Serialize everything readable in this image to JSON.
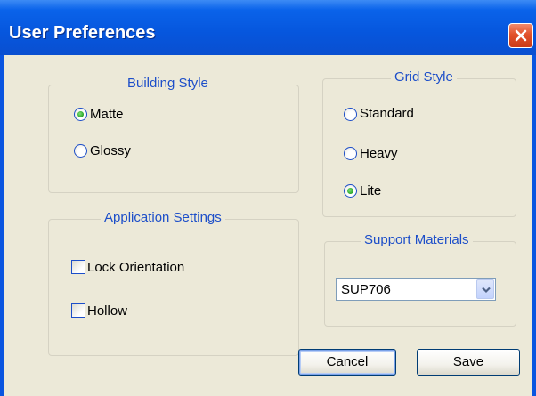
{
  "window": {
    "title": "User Preferences"
  },
  "building_style": {
    "legend": "Building Style",
    "options": [
      {
        "label": "Matte",
        "selected": true
      },
      {
        "label": "Glossy",
        "selected": false
      }
    ]
  },
  "grid_style": {
    "legend": "Grid Style",
    "options": [
      {
        "label": "Standard",
        "selected": false
      },
      {
        "label": "Heavy",
        "selected": false
      },
      {
        "label": "Lite",
        "selected": true
      }
    ]
  },
  "application_settings": {
    "legend": "Application Settings",
    "options": [
      {
        "label": "Lock Orientation",
        "checked": false
      },
      {
        "label": "Hollow",
        "checked": false
      }
    ]
  },
  "support_materials": {
    "legend": "Support Materials",
    "selected": "SUP706"
  },
  "buttons": {
    "cancel": "Cancel",
    "save": "Save"
  },
  "colors": {
    "title_bar": "#0a55e0",
    "dialog_bg": "#ece9d8",
    "legend_text": "#1c4ec9",
    "close_button": "#e2522b",
    "radio_dot": "#26a324"
  },
  "icons": {
    "close": "close-icon",
    "dropdown": "chevron-down-icon"
  }
}
